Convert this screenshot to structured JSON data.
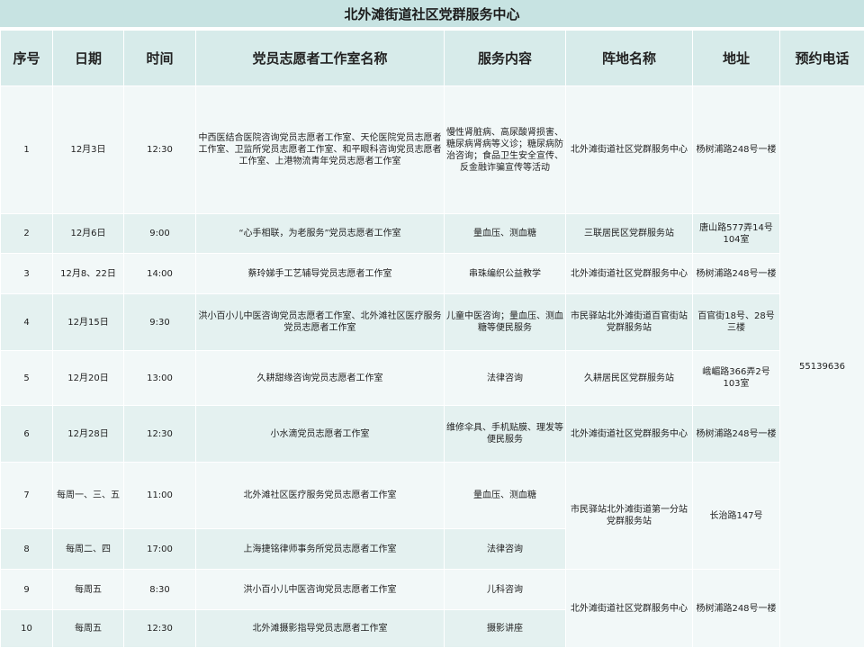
{
  "title": "北外滩街道社区党群服务中心",
  "headers": [
    "序号",
    "日期",
    "时间",
    "党员志愿者工作室名称",
    "服务内容",
    "阵地名称",
    "地址",
    "预约电话"
  ],
  "phone": "55139636",
  "rows": [
    {
      "no": "1",
      "date": "12月3日",
      "time": "12:30",
      "studio": "中西医结合医院咨询党员志愿者工作室、天伦医院党员志愿者工作室、卫监所党员志愿者工作室、和平眼科咨询党员志愿者工作室、上港物流青年党员志愿者工作室",
      "content": "慢性肾脏病、高尿酸肾损害、糖尿病肾病等义诊；糖尿病防治咨询；食品卫生安全宣传、反金融诈骗宣传等活动",
      "site": "北外滩街道社区党群服务中心",
      "address": "杨树浦路248号一楼"
    },
    {
      "no": "2",
      "date": "12月6日",
      "time": "9:00",
      "studio": "“心手相联，为老服务”党员志愿者工作室",
      "content": "量血压、测血糖",
      "site": "三联居民区党群服务站",
      "address": "唐山路577弄14号104室"
    },
    {
      "no": "3",
      "date": "12月8、22日",
      "time": "14:00",
      "studio": "蔡玲娣手工艺辅导党员志愿者工作室",
      "content": "串珠编织公益教学",
      "site": "北外滩街道社区党群服务中心",
      "address": "杨树浦路248号一楼"
    },
    {
      "no": "4",
      "date": "12月15日",
      "time": "9:30",
      "studio": "洪小百小儿中医咨询党员志愿者工作室、北外滩社区医疗服务党员志愿者工作室",
      "content": "儿童中医咨询；量血压、测血糖等便民服务",
      "site": "市民驿站北外滩街道百官街站党群服务站",
      "address": "百官街18号、28号三楼"
    },
    {
      "no": "5",
      "date": "12月20日",
      "time": "13:00",
      "studio": "久耕甜缘咨询党员志愿者工作室",
      "content": "法律咨询",
      "site": "久耕居民区党群服务站",
      "address": "峨嵋路366弄2号103室"
    },
    {
      "no": "6",
      "date": "12月28日",
      "time": "12:30",
      "studio": "小水滴党员志愿者工作室",
      "content": "维修伞具、手机贴膜、理发等便民服务",
      "site": "北外滩街道社区党群服务中心",
      "address": "杨树浦路248号一楼"
    },
    {
      "no": "7",
      "date": "每周一、三、五",
      "time": "11:00",
      "studio": "北外滩社区医疗服务党员志愿者工作室",
      "content": "量血压、测血糖"
    },
    {
      "no": "8",
      "date": "每周二、四",
      "time": "17:00",
      "studio": "上海捷铭律师事务所党员志愿者工作室",
      "content": "法律咨询"
    },
    {
      "no": "9",
      "date": "每周五",
      "time": "8:30",
      "studio": "洪小百小儿中医咨询党员志愿者工作室",
      "content": "儿科咨询"
    },
    {
      "no": "10",
      "date": "每周五",
      "time": "12:30",
      "studio": "北外滩摄影指导党员志愿者工作室",
      "content": "摄影讲座"
    }
  ],
  "merged": {
    "site_7_8": "市民驿站北外滩街道第一分站党群服务站",
    "address_7_8": "长治路147号",
    "site_9_10": "北外滩街道社区党群服务中心",
    "address_9_10": "杨树浦路248号一楼"
  }
}
